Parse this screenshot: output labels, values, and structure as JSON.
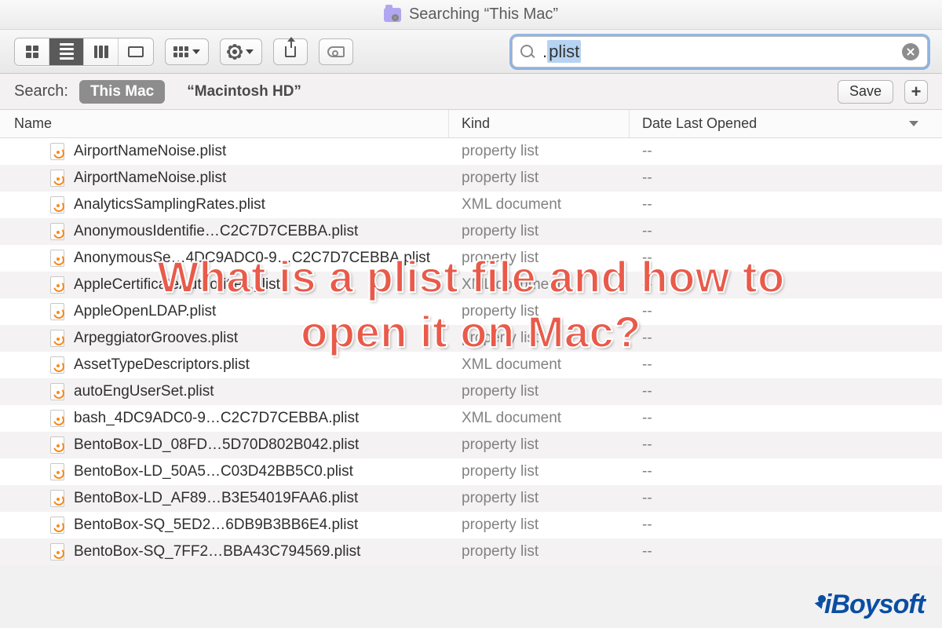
{
  "titlebar": {
    "text": "Searching “This Mac”"
  },
  "toolbar": {
    "search_value": ".plist",
    "search_selection": "plist"
  },
  "scopebar": {
    "label": "Search:",
    "this_mac": "This Mac",
    "volume": "“Macintosh HD”",
    "save_label": "Save",
    "plus_label": "+"
  },
  "columns": {
    "name": "Name",
    "kind": "Kind",
    "date": "Date Last Opened"
  },
  "rows": [
    {
      "name": "AirportNameNoise.plist",
      "kind": "property list",
      "date": "--"
    },
    {
      "name": "AirportNameNoise.plist",
      "kind": "property list",
      "date": "--"
    },
    {
      "name": "AnalyticsSamplingRates.plist",
      "kind": "XML document",
      "date": "--"
    },
    {
      "name": "AnonymousIdentifie…C2C7D7CEBBA.plist",
      "kind": "property list",
      "date": "--"
    },
    {
      "name": "AnonymousSe…4DC9ADC0-9…C2C7D7CEBBA.plist",
      "kind": "property list",
      "date": "--"
    },
    {
      "name": "AppleCertificateAuthorities.plist",
      "kind": "XML document",
      "date": "--"
    },
    {
      "name": "AppleOpenLDAP.plist",
      "kind": "property list",
      "date": "--"
    },
    {
      "name": "ArpeggiatorGrooves.plist",
      "kind": "property list",
      "date": "--"
    },
    {
      "name": "AssetTypeDescriptors.plist",
      "kind": "XML document",
      "date": "--"
    },
    {
      "name": "autoEngUserSet.plist",
      "kind": "property list",
      "date": "--"
    },
    {
      "name": "bash_4DC9ADC0-9…C2C7D7CEBBA.plist",
      "kind": "XML document",
      "date": "--"
    },
    {
      "name": "BentoBox-LD_08FD…5D70D802B042.plist",
      "kind": "property list",
      "date": "--"
    },
    {
      "name": "BentoBox-LD_50A5…C03D42BB5C0.plist",
      "kind": "property list",
      "date": "--"
    },
    {
      "name": "BentoBox-LD_AF89…B3E54019FAA6.plist",
      "kind": "property list",
      "date": "--"
    },
    {
      "name": "BentoBox-SQ_5ED2…6DB9B3BB6E4.plist",
      "kind": "property list",
      "date": "--"
    },
    {
      "name": "BentoBox-SQ_7FF2…BBA43C794569.plist",
      "kind": "property list",
      "date": "--"
    }
  ],
  "overlay": {
    "line1": "What is a plist file and how to",
    "line2": "open it on Mac?"
  },
  "watermark": {
    "text": "iBoysoft"
  }
}
